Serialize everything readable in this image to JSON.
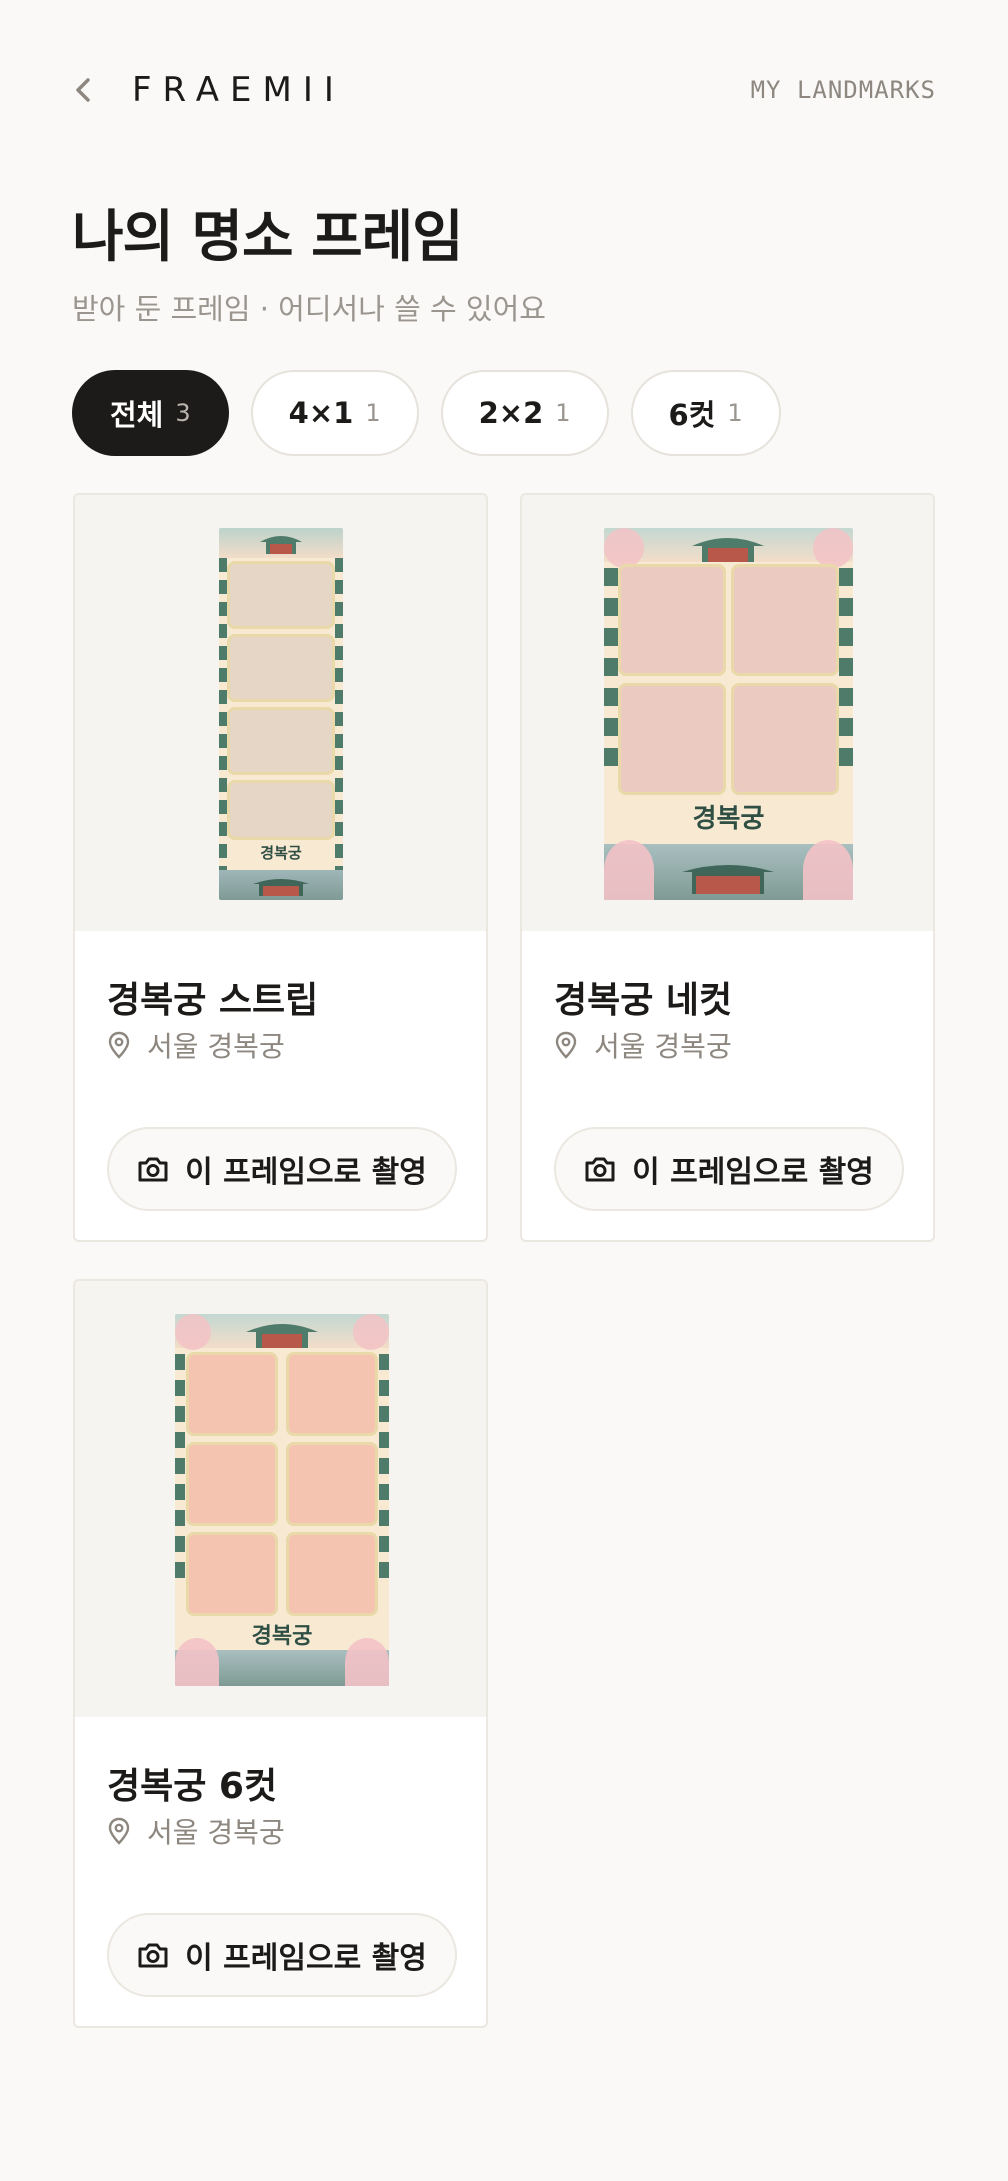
{
  "header": {
    "brand": "FRAEMII",
    "my_landmarks": "MY LANDMARKS"
  },
  "page": {
    "title": "나의 명소 프레임",
    "subtitle": "받아 둔 프레임 · 어디서나 쓸 수 있어요"
  },
  "filters": [
    {
      "label": "전체",
      "count": "3",
      "active": true
    },
    {
      "label": "4×1",
      "count": "1",
      "active": false
    },
    {
      "label": "2×2",
      "count": "1",
      "active": false
    },
    {
      "label": "6컷",
      "count": "1",
      "active": false
    }
  ],
  "cards": [
    {
      "name": "경복궁 스트립",
      "location": "서울 경복궁",
      "button": "이 프레임으로 촬영",
      "frame_title": "경복궁",
      "layout": "4x1"
    },
    {
      "name": "경복궁 네컷",
      "location": "서울 경복궁",
      "button": "이 프레임으로 촬영",
      "frame_title": "경복궁",
      "layout": "2x2"
    },
    {
      "name": "경복궁 6컷",
      "location": "서울 경복궁",
      "button": "이 프레임으로 촬영",
      "frame_title": "경복궁",
      "layout": "6cut"
    }
  ],
  "colors": {
    "background": "#faf9f7",
    "text": "#1d1b19",
    "muted": "#8d8780",
    "chip_active": "#1d1b19",
    "frame_cream": "#f8ead2",
    "frame_green": "#4f7b6b",
    "slot_strip": "#e6d6c6",
    "slot_2x2": "#ebcbc1",
    "slot_6cut": "#f5c4b0",
    "blossom": "#f3c2c6"
  },
  "icons": {
    "back": "chevron-left-icon",
    "location": "map-pin-icon",
    "camera": "camera-icon"
  }
}
